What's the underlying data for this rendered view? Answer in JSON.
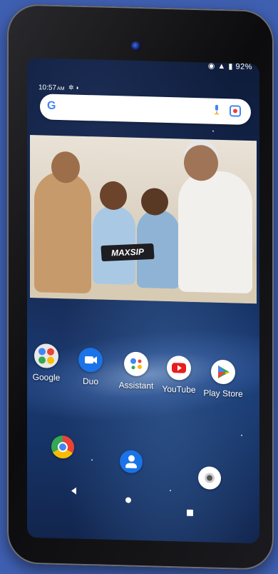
{
  "status": {
    "time": "10:57",
    "time_suffix": "AM",
    "battery": "92%"
  },
  "search": {
    "logo": "G"
  },
  "photo": {
    "brand_text": "MAXSIP"
  },
  "apps": [
    {
      "label": "Google",
      "icon": "google-folder-icon"
    },
    {
      "label": "Duo",
      "icon": "duo-icon"
    },
    {
      "label": "Assistant",
      "icon": "assistant-icon"
    },
    {
      "label": "YouTube",
      "icon": "youtube-icon"
    },
    {
      "label": "Play Store",
      "icon": "play-store-icon"
    }
  ],
  "dock": [
    {
      "icon": "chrome-icon"
    },
    {
      "icon": "contacts-icon"
    },
    {
      "icon": "camera-icon"
    }
  ],
  "colors": {
    "background": "#3f5fb1",
    "google_blue": "#4285f4",
    "google_red": "#ea4335",
    "google_yellow": "#fbbc05",
    "google_green": "#34a853"
  }
}
